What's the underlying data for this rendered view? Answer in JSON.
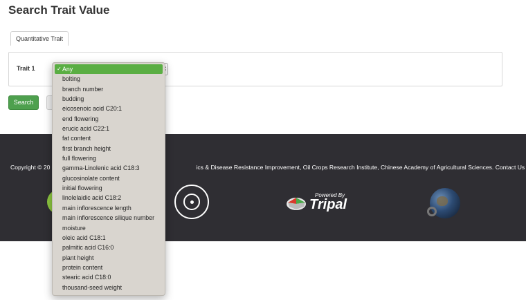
{
  "page": {
    "title": "Search Trait Value"
  },
  "tabs": [
    {
      "label": "Quantitative Trait"
    }
  ],
  "form": {
    "trait_label": "Trait 1",
    "select": {
      "selected": "Any",
      "options": [
        "Any",
        "bolting",
        "branch number",
        "budding",
        "eicosenoic acid C20:1",
        "end flowering",
        "erucic acid C22:1",
        "fat content",
        "first branch height",
        "full flowering",
        "gamma-Linolenic acid C18:3",
        "glucosinolate content",
        "initial flowering",
        "linolelaidic acid C18:2",
        "main inflorescence length",
        "main inflorescence silique number",
        "moisture",
        "oleic acid C18:1",
        "palmitic acid C16:0",
        "plant height",
        "protein content",
        "stearic acid C18:0",
        "thousand-seed weight"
      ]
    },
    "search_label": "Search"
  },
  "footer": {
    "copyright_start": "Copyright © 20",
    "copyright_end": "ics & Disease Resistance Improvement, Oil Crops Research Institute, Chinese Academy of Agricultural Sciences. Contact Us",
    "tripal_powered": "Powered By",
    "tripal_name": "Tripal"
  },
  "colors": {
    "accent_green": "#4ea04e",
    "selected_option": "#5aae43",
    "footer_bg": "#2f2e33",
    "dropdown_bg": "#d9d5cf"
  }
}
